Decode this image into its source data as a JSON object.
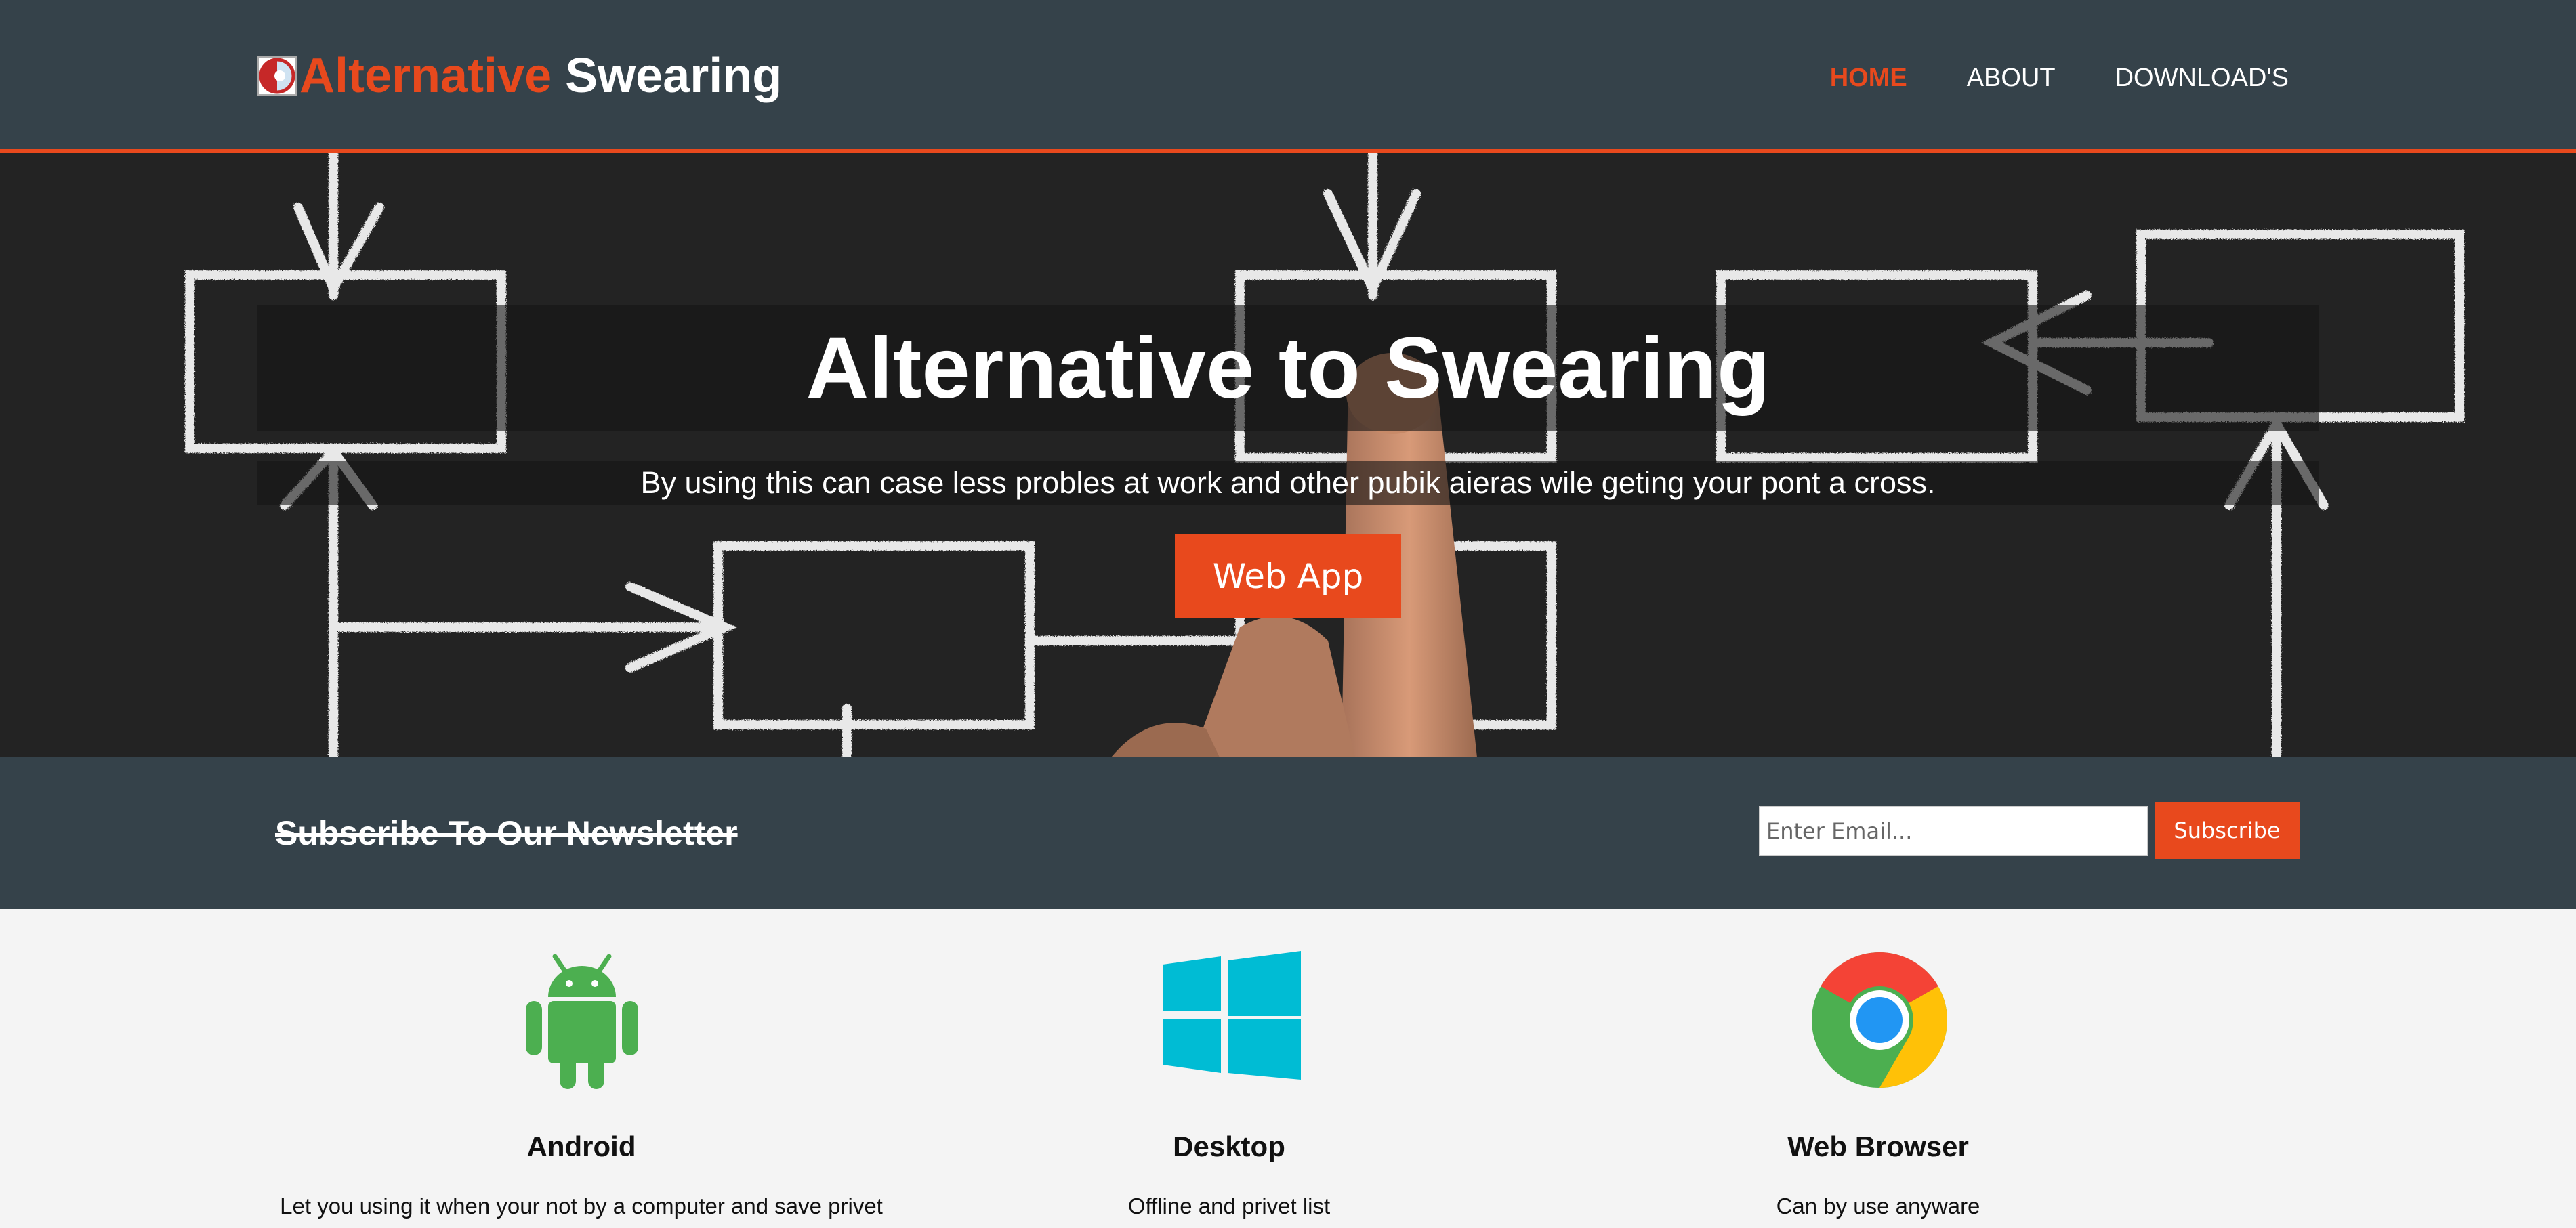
{
  "header": {
    "brand_accent": "Alternative",
    "brand_rest": "Swearing",
    "nav": [
      "HOME",
      "ABOUT",
      "DOWNLOAD'S"
    ],
    "active_nav": "HOME"
  },
  "hero": {
    "title": "Alternative to Swearing",
    "subtitle": "By using this can case less probles at work and other pubik aieras wile geting your pont a cross.",
    "button": "Web App"
  },
  "newsletter": {
    "title": "Subscribe To Our Newsletter",
    "email_placeholder": "Enter Email...",
    "button": "Subscribe"
  },
  "features": [
    {
      "icon": "android-icon",
      "title": "Android",
      "text": "Let you using it when your not by a computer and save privet"
    },
    {
      "icon": "windows-icon",
      "title": "Desktop",
      "text": "Offline and privet list"
    },
    {
      "icon": "chrome-icon",
      "title": "Web Browser",
      "text": "Can by use anyware"
    }
  ],
  "colors": {
    "accent": "#e8491d",
    "dark": "#35424a",
    "android": "#4caf50",
    "windows": "#00bcd4"
  }
}
